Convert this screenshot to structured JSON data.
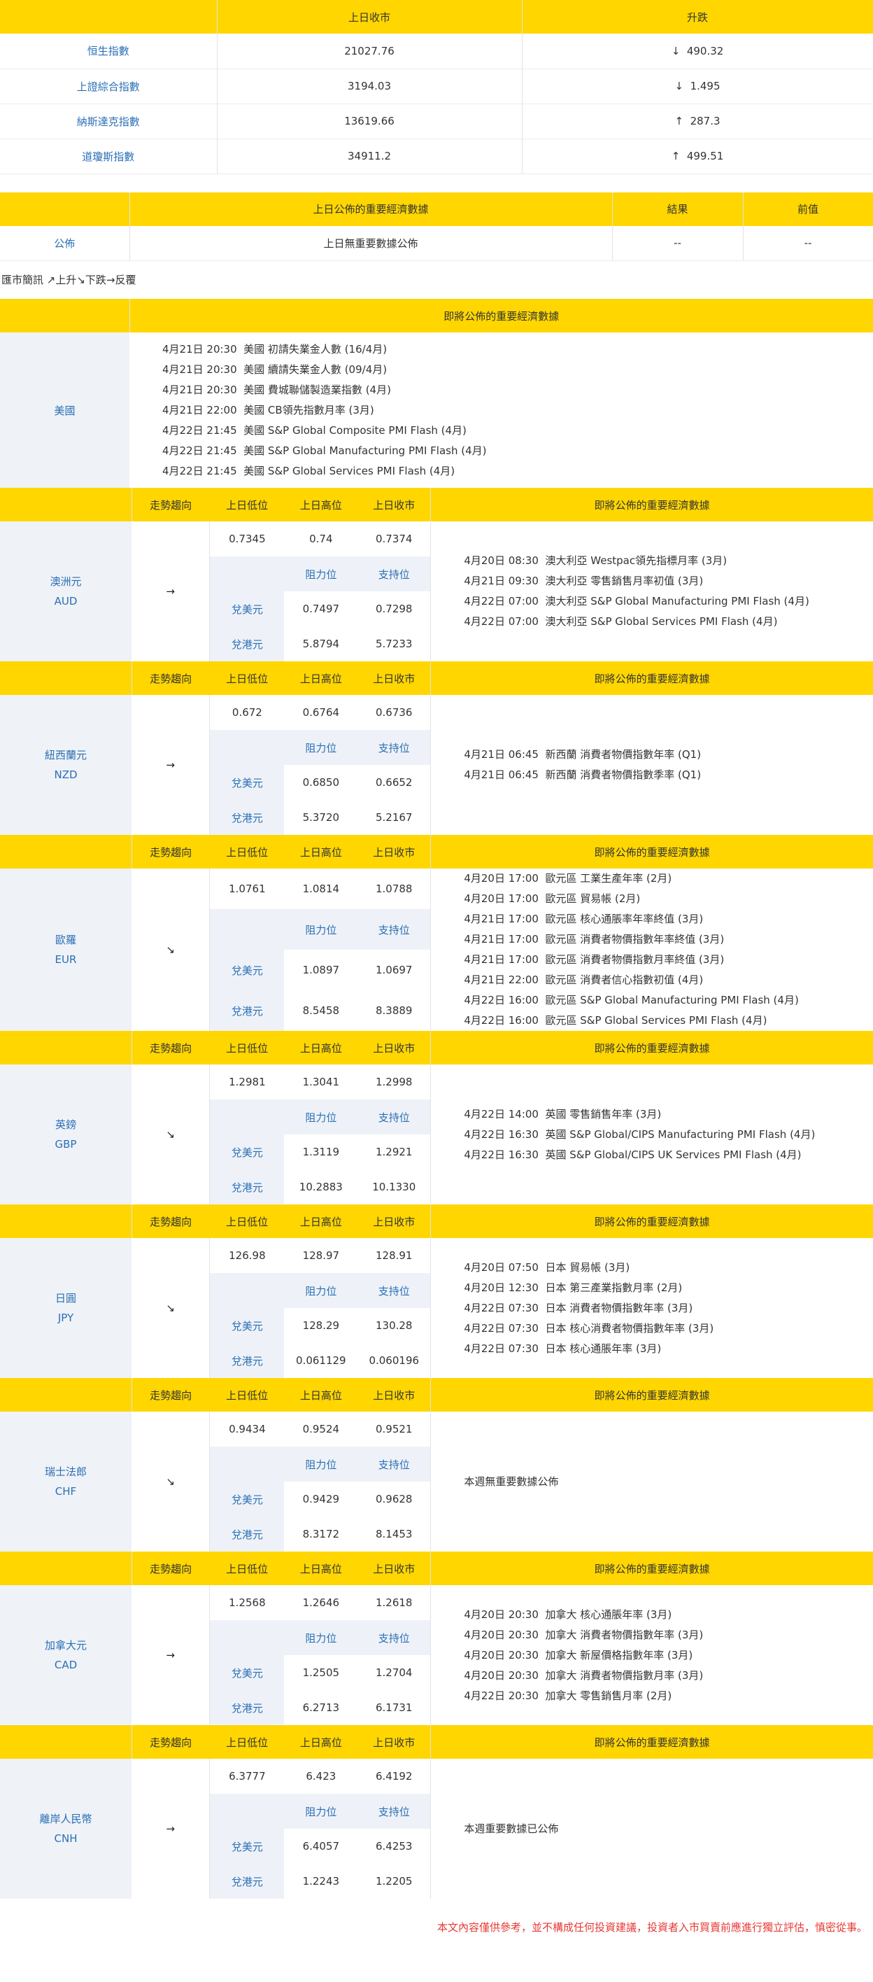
{
  "indices": {
    "headers": [
      "",
      "上日收市",
      "升跌"
    ],
    "rows": [
      {
        "name": "恒生指數",
        "close": "21027.76",
        "dir": "↓",
        "change": "490.32"
      },
      {
        "name": "上證綜合指數",
        "close": "3194.03",
        "dir": "↓",
        "change": "1.495"
      },
      {
        "name": "納斯達克指數",
        "close": "13619.66",
        "dir": "↑",
        "change": "287.3"
      },
      {
        "name": "道瓊斯指數",
        "close": "34911.2",
        "dir": "↑",
        "change": "499.51"
      }
    ]
  },
  "calendar": {
    "headers": [
      "",
      "上日公佈的重要經濟數據",
      "結果",
      "前值"
    ],
    "row": {
      "label": "公佈",
      "text": "上日無重要數據公佈",
      "result": "--",
      "prev": "--"
    }
  },
  "legend": "匯市簡訊 ↗上升↘下跌→反覆",
  "upcoming_header": "即將公佈的重要經濟數據",
  "us": {
    "name": "美國",
    "events": [
      "4月21日 20:30  美國 初請失業金人數 (16/4月)",
      "4月21日 20:30  美國 續請失業金人數 (09/4月)",
      "4月21日 20:30  美國 費城聯儲製造業指數 (4月)",
      "4月21日 22:00  美國 CB領先指數月率 (3月)",
      "4月22日 21:45  美國 S&P Global Composite PMI Flash (4月)",
      "4月22日 21:45  美國 S&P Global Manufacturing PMI Flash (4月)",
      "4月22日 21:45  美國 S&P Global Services PMI Flash (4月)"
    ]
  },
  "col_headers": {
    "trend": "走勢趨向",
    "low": "上日低位",
    "high": "上日高位",
    "close": "上日收市",
    "events": "即將公佈的重要經濟數據",
    "resistance": "阻力位",
    "support": "支持位"
  },
  "currencies": [
    {
      "name": "澳洲元",
      "code": "AUD",
      "trend": "→",
      "low": "0.7345",
      "high": "0.74",
      "close": "0.7374",
      "pair1": "兌美元",
      "r1": "0.7497",
      "s1": "0.7298",
      "pair2": "兌港元",
      "r2": "5.8794",
      "s2": "5.7233",
      "events": [
        "4月20日 08:30  澳大利亞 Westpac領先指標月率 (3月)",
        "4月21日 09:30  澳大利亞 零售銷售月率初值 (3月)",
        "4月22日 07:00  澳大利亞 S&P Global Manufacturing PMI Flash (4月)",
        "4月22日 07:00  澳大利亞 S&P Global Services PMI Flash (4月)"
      ]
    },
    {
      "name": "紐西蘭元",
      "code": "NZD",
      "trend": "→",
      "low": "0.672",
      "high": "0.6764",
      "close": "0.6736",
      "pair1": "兌美元",
      "r1": "0.6850",
      "s1": "0.6652",
      "pair2": "兌港元",
      "r2": "5.3720",
      "s2": "5.2167",
      "events": [
        "4月21日 06:45  新西蘭 消費者物價指數年率 (Q1)",
        "4月21日 06:45  新西蘭 消費者物價指數季率 (Q1)"
      ]
    },
    {
      "name": "歐羅",
      "code": "EUR",
      "trend": "↘",
      "low": "1.0761",
      "high": "1.0814",
      "close": "1.0788",
      "pair1": "兌美元",
      "r1": "1.0897",
      "s1": "1.0697",
      "pair2": "兌港元",
      "r2": "8.5458",
      "s2": "8.3889",
      "events": [
        "4月20日 17:00  歐元區 工業生產年率 (2月)",
        "4月20日 17:00  歐元區 貿易帳 (2月)",
        "4月21日 17:00  歐元區 核心通脹率年率終值 (3月)",
        "4月21日 17:00  歐元區 消費者物價指數年率終值 (3月)",
        "4月21日 17:00  歐元區 消費者物價指數月率終值 (3月)",
        "4月21日 22:00  歐元區 消費者信心指數初值 (4月)",
        "4月22日 16:00  歐元區 S&P Global Manufacturing PMI Flash (4月)",
        "4月22日 16:00  歐元區 S&P Global Services PMI Flash (4月)"
      ]
    },
    {
      "name": "英鎊",
      "code": "GBP",
      "trend": "↘",
      "low": "1.2981",
      "high": "1.3041",
      "close": "1.2998",
      "pair1": "兌美元",
      "r1": "1.3119",
      "s1": "1.2921",
      "pair2": "兌港元",
      "r2": "10.2883",
      "s2": "10.1330",
      "events": [
        "4月22日 14:00  英國 零售銷售年率 (3月)",
        "4月22日 16:30  英國 S&P Global/CIPS Manufacturing PMI Flash (4月)",
        "4月22日 16:30  英國 S&P Global/CIPS UK Services PMI Flash (4月)"
      ]
    },
    {
      "name": "日圓",
      "code": "JPY",
      "trend": "↘",
      "low": "126.98",
      "high": "128.97",
      "close": "128.91",
      "pair1": "兌美元",
      "r1": "128.29",
      "s1": "130.28",
      "pair2": "兌港元",
      "r2": "0.061129",
      "s2": "0.060196",
      "events": [
        "4月20日 07:50  日本 貿易帳 (3月)",
        "4月20日 12:30  日本 第三產業指數月率 (2月)",
        "4月22日 07:30  日本 消費者物價指數年率 (3月)",
        "4月22日 07:30  日本 核心消費者物價指數年率 (3月)",
        "4月22日 07:30  日本 核心通脹年率 (3月)"
      ]
    },
    {
      "name": "瑞士法郎",
      "code": "CHF",
      "trend": "↘",
      "low": "0.9434",
      "high": "0.9524",
      "close": "0.9521",
      "pair1": "兌美元",
      "r1": "0.9429",
      "s1": "0.9628",
      "pair2": "兌港元",
      "r2": "8.3172",
      "s2": "8.1453",
      "events": [
        "本週無重要數據公佈"
      ]
    },
    {
      "name": "加拿大元",
      "code": "CAD",
      "trend": "→",
      "low": "1.2568",
      "high": "1.2646",
      "close": "1.2618",
      "pair1": "兌美元",
      "r1": "1.2505",
      "s1": "1.2704",
      "pair2": "兌港元",
      "r2": "6.2713",
      "s2": "6.1731",
      "events": [
        "4月20日 20:30  加拿大 核心通脹年率 (3月)",
        "4月20日 20:30  加拿大 消費者物價指數年率 (3月)",
        "4月20日 20:30  加拿大 新屋價格指數年率 (3月)",
        "4月20日 20:30  加拿大 消費者物價指數月率 (3月)",
        "4月22日 20:30  加拿大 零售銷售月率 (2月)"
      ]
    },
    {
      "name": "離岸人民幣",
      "code": "CNH",
      "trend": "→",
      "low": "6.3777",
      "high": "6.423",
      "close": "6.4192",
      "pair1": "兌美元",
      "r1": "6.4057",
      "s1": "6.4253",
      "pair2": "兌港元",
      "r2": "1.2243",
      "s2": "1.2205",
      "events": [
        "本週重要數據已公佈"
      ]
    }
  ],
  "footer": "本文內容僅供參考，並不構成任何投資建議，投資者入市買賣前應進行獨立評估，慎密從事。"
}
